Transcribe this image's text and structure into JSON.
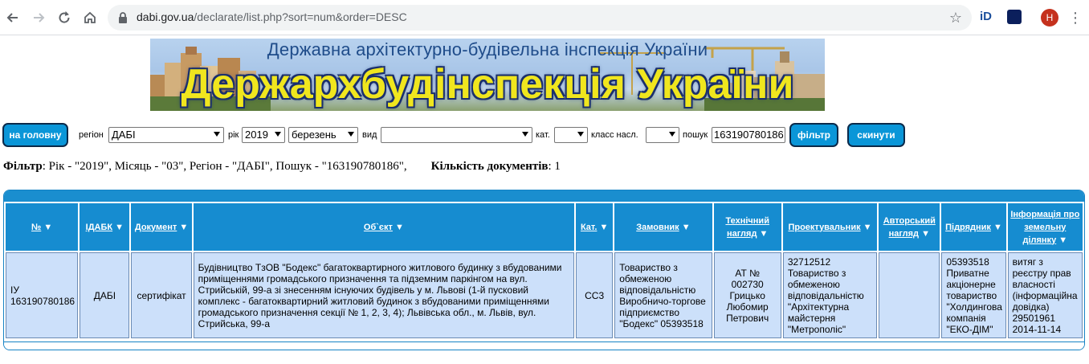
{
  "browser": {
    "url_host": "dabi.gov.ua",
    "url_path": "/declarate/list.php?sort=num&order=DESC",
    "ext1_label": "iD",
    "avatar_letter": "Н"
  },
  "banner": {
    "subtitle": "Державна архітектурно-будівельна інспекція України",
    "title": "Держархбудінспекція України"
  },
  "filters": {
    "home_button": "на головну",
    "region_label": "регіон",
    "region_value": "ДАБІ",
    "year_label": "рік",
    "year_value": "2019",
    "month_value": "березень",
    "type_label": "вид",
    "type_value": "",
    "category_label": "кат.",
    "category_value": "",
    "class_label": "класс насл.",
    "class_value": "",
    "search_label": "пошук",
    "search_value": "163190780186",
    "filter_button": "фільтр",
    "reset_button": "скинути"
  },
  "summary": {
    "filter_label": "Фільтр",
    "filter_text": ": Рік - \"2019\", Місяць - \"03\", Регіон - \"ДАБІ\", Пошук - \"163190780186\",",
    "count_label": "Кількість документів",
    "count_value": ": 1"
  },
  "table": {
    "columns": [
      "№",
      "ІДАБК",
      "Документ",
      "Об`єкт",
      "Кат.",
      "Замовник",
      "Технічний нагляд",
      "Проектувальник",
      "Авторський нагляд",
      "Підрядник",
      "Інформація про земельну ділянку"
    ],
    "sort_indicator": "▼",
    "rows": [
      {
        "num": "ІУ 163190780186",
        "idabk": "ДАБІ",
        "document": "сертифікат",
        "object": "Будівництво ТзОВ \"Бодекс\" багатоквартирного житлового будинку з вбудованими приміщеннями громадського призначення та підземним паркінгом на вул. Стрийській, 99-а зі знесенням існуючих будівель у м. Львові (1-й пусковий комплекс - багатоквартирний житловий будинок з вбудованими приміщеннями громадського призначення секції № 1, 2, 3, 4); Львівська обл., м. Львів, вул. Стрийська, 99-а",
        "category": "СС3",
        "customer": "Товариство з обмеженою відповідальністю Виробничо-торгове підприємство \"Бодекс\" 05393518",
        "tech_supervision": "АТ № 002730 Грицько Любомир Петрович",
        "designer": "32712512 Товариство з обмеженою відповідальністю \"Архітектурна майстерня \"Метрополіс\"",
        "author_supervision": "",
        "contractor": "05393518 Приватне акціонерне товариство \"Холдингова компанія \"ЕКО-ДІМ\"",
        "land_info": "витяг з реєстру прав власності (інформаційна довідка) 29501961 2014-11-14"
      }
    ]
  },
  "colors": {
    "header_blue": "#168cd0",
    "cell_blue": "#cce0fa",
    "button_blue": "#0a96d8",
    "banner_yellow": "#f0e61e"
  }
}
